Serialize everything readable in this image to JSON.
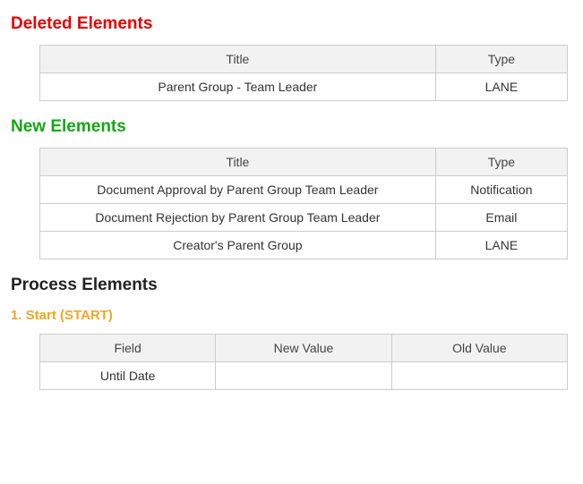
{
  "deleted": {
    "heading": "Deleted Elements",
    "columns": {
      "title": "Title",
      "type": "Type"
    },
    "rows": [
      {
        "title": "Parent Group - Team Leader",
        "type": "LANE"
      }
    ]
  },
  "newelems": {
    "heading": "New Elements",
    "columns": {
      "title": "Title",
      "type": "Type"
    },
    "rows": [
      {
        "title": "Document Approval by Parent Group Team Leader",
        "type": "Notification"
      },
      {
        "title": "Document Rejection by Parent Group Team Leader",
        "type": "Email"
      },
      {
        "title": "Creator's Parent Group",
        "type": "LANE"
      }
    ]
  },
  "process": {
    "heading": "Process Elements",
    "sub": "1. Start (START)",
    "columns": {
      "field": "Field",
      "newval": "New Value",
      "oldval": "Old Value"
    },
    "rows": [
      {
        "field": "Until Date",
        "newval": "",
        "oldval": ""
      }
    ]
  }
}
